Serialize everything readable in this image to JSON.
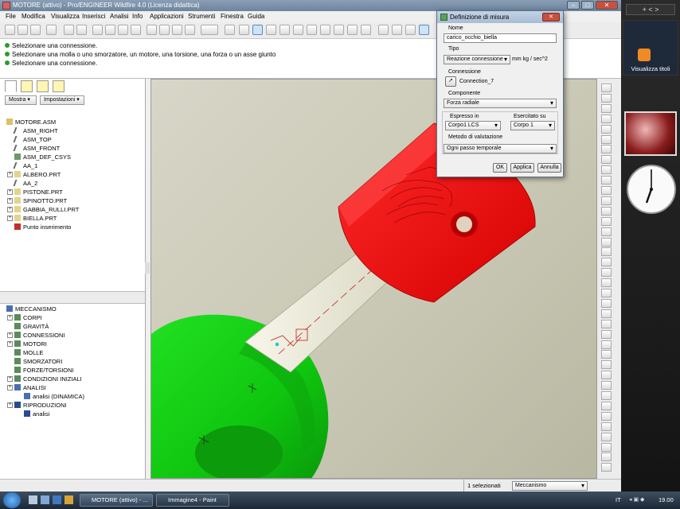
{
  "window": {
    "title": "MOTORE (attivo) - Pro/ENGINEER Wildfire 4.0 (Licenza didattica)"
  },
  "menu": [
    "File",
    "Modifica",
    "Visualizza",
    "Inserisci",
    "Analisi",
    "Info",
    "Applicazioni",
    "Strumenti",
    "Finestra",
    "Guida"
  ],
  "messages": [
    "Selezionare una connessione.",
    "Selezionare una molla o uno smorzatore, un motore, una torsione, una forza o un asse giunto",
    "Selezionare una connessione."
  ],
  "left_panel": {
    "show_button": "Mostra",
    "settings_button": "Impostazioni",
    "model_tree": [
      {
        "label": "MOTORE.ASM",
        "level": 0,
        "icon": "assembly-icon",
        "expander": false
      },
      {
        "label": "ASM_RIGHT",
        "level": 1,
        "icon": "datum-plane-icon",
        "expander": false
      },
      {
        "label": "ASM_TOP",
        "level": 1,
        "icon": "datum-plane-icon",
        "expander": false
      },
      {
        "label": "ASM_FRONT",
        "level": 1,
        "icon": "datum-plane-icon",
        "expander": false
      },
      {
        "label": "ASM_DEF_CSYS",
        "level": 1,
        "icon": "csys-icon",
        "expander": false
      },
      {
        "label": "AA_1",
        "level": 1,
        "icon": "axis-icon",
        "expander": false
      },
      {
        "label": "ALBERO.PRT",
        "level": 1,
        "icon": "part-icon",
        "expander": true
      },
      {
        "label": "AA_2",
        "level": 1,
        "icon": "axis-icon",
        "expander": false
      },
      {
        "label": "PISTONE.PRT",
        "level": 1,
        "icon": "part-icon",
        "expander": true
      },
      {
        "label": "SPINOTTO.PRT",
        "level": 1,
        "icon": "part-icon",
        "expander": true
      },
      {
        "label": "GABBIA_RULLI.PRT",
        "level": 1,
        "icon": "part-icon",
        "expander": true
      },
      {
        "label": "BIELLA.PRT",
        "level": 1,
        "icon": "part-icon",
        "expander": true
      },
      {
        "label": "Punto inserimento",
        "level": 1,
        "icon": "insert-arrow-icon",
        "expander": false
      }
    ],
    "mechanism_tree": [
      {
        "label": "MECCANISMO",
        "level": 0,
        "icon": "mechanism-icon",
        "expander": false
      },
      {
        "label": "CORPI",
        "level": 1,
        "icon": "bodies-icon",
        "expander": true
      },
      {
        "label": "GRAVITÀ",
        "level": 1,
        "icon": "gravity-icon",
        "expander": false
      },
      {
        "label": "CONNESSIONI",
        "level": 1,
        "icon": "connections-icon",
        "expander": true
      },
      {
        "label": "MOTORI",
        "level": 1,
        "icon": "motors-icon",
        "expander": true
      },
      {
        "label": "MOLLE",
        "level": 1,
        "icon": "springs-icon",
        "expander": false
      },
      {
        "label": "SMORZATORI",
        "level": 1,
        "icon": "dampers-icon",
        "expander": false
      },
      {
        "label": "FORZE/TORSIONI",
        "level": 1,
        "icon": "forces-icon",
        "expander": false
      },
      {
        "label": "CONDIZIONI INIZIALI",
        "level": 1,
        "icon": "initial-conditions-icon",
        "expander": true
      },
      {
        "label": "ANALISI",
        "level": 1,
        "icon": "analysis-icon",
        "expander": true
      },
      {
        "label": "analisi (DINAMICA)",
        "level": 2,
        "icon": "analysis-item-icon",
        "expander": false
      },
      {
        "label": "RIPRODUZIONI",
        "level": 1,
        "icon": "playback-icon",
        "expander": true
      },
      {
        "label": "analisi",
        "level": 2,
        "icon": "playback-item-icon",
        "expander": false
      }
    ]
  },
  "dialog": {
    "title": "Definizione di misura",
    "name_label": "Nome",
    "name_value": "carico_occhio_biella",
    "type_label": "Tipo",
    "type_value": "Reazione connessione",
    "type_units": "mm kg / sec^2",
    "connection_label": "Connessione",
    "connection_value": "Connection_7",
    "component_label": "Componente",
    "component_value": "Forza radiale",
    "expressed_label": "Espresso in",
    "expressed_value": "Corpo1 LCS",
    "exerted_label": "Esercitato su",
    "exerted_value": "Corpo 1",
    "eval_label": "Metodo di valutazione",
    "eval_value": "Ogni passo temporale",
    "ok": "OK",
    "apply": "Applica",
    "cancel": "Annulla"
  },
  "status": {
    "selected": "1 selezionati",
    "filter": "Meccanismo"
  },
  "sidebar": {
    "feed_label": "Visualizza titoli"
  },
  "taskbar": {
    "tasks": [
      "MOTORE (attivo) - ...",
      "Immagine4 - Paint"
    ],
    "lang": "IT",
    "time": "19.00"
  },
  "colors": {
    "piston": "#ee1111",
    "crankshaft": "#11cc11",
    "rod": "#ecebd8",
    "viewport_bg": "#cfcebb"
  }
}
